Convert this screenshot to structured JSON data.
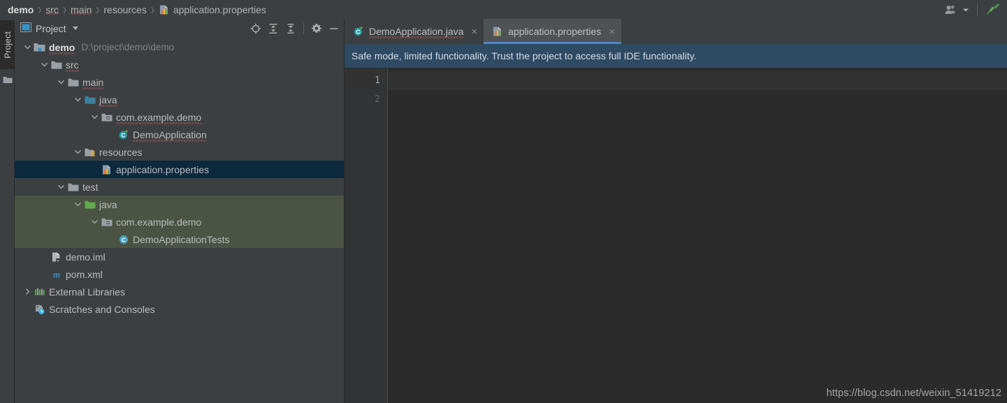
{
  "navbar": {
    "crumbs": [
      {
        "label": "demo",
        "icon": "",
        "root": true,
        "squiggle": false
      },
      {
        "label": "src",
        "icon": "",
        "root": false,
        "squiggle": true
      },
      {
        "label": "main",
        "icon": "",
        "root": false,
        "squiggle": true
      },
      {
        "label": "resources",
        "icon": "",
        "root": false,
        "squiggle": false
      },
      {
        "label": "application.properties",
        "icon": "properties-file-icon",
        "root": false,
        "squiggle": false
      }
    ],
    "separator": "›",
    "right_icons": [
      {
        "name": "user-account-icon",
        "label": ""
      },
      {
        "name": "chevron-down-icon",
        "label": ""
      },
      {
        "name": "build-hammer-icon",
        "label": ""
      }
    ]
  },
  "toolstrip": {
    "tab_label": "Project",
    "icon_name": "folder-icon"
  },
  "project_panel": {
    "title": "Project",
    "actions": [
      {
        "name": "select-opened-file-icon",
        "tooltip": "Select Opened File"
      },
      {
        "name": "expand-all-icon",
        "tooltip": "Expand All"
      },
      {
        "name": "collapse-all-icon",
        "tooltip": "Collapse All"
      },
      {
        "name": "settings-gear-icon",
        "tooltip": "Settings"
      },
      {
        "name": "hide-panel-icon",
        "tooltip": "Hide"
      }
    ],
    "tree": [
      {
        "label": "demo",
        "sub": "D:\\project\\demo\\demo",
        "depth": 0,
        "arrow": "expanded",
        "icon": "module-folder-icon",
        "bold": true,
        "selected": false,
        "testzone": false,
        "squiggle": true
      },
      {
        "label": "src",
        "sub": "",
        "depth": 1,
        "arrow": "expanded",
        "icon": "folder-icon",
        "bold": false,
        "selected": false,
        "testzone": false,
        "squiggle": true
      },
      {
        "label": "main",
        "sub": "",
        "depth": 2,
        "arrow": "expanded",
        "icon": "folder-icon",
        "bold": false,
        "selected": false,
        "testzone": false,
        "squiggle": true
      },
      {
        "label": "java",
        "sub": "",
        "depth": 3,
        "arrow": "expanded",
        "icon": "source-folder-icon",
        "bold": false,
        "selected": false,
        "testzone": false,
        "squiggle": true
      },
      {
        "label": "com.example.demo",
        "sub": "",
        "depth": 4,
        "arrow": "expanded",
        "icon": "package-icon",
        "bold": false,
        "selected": false,
        "testzone": false,
        "squiggle": true
      },
      {
        "label": "DemoApplication",
        "sub": "",
        "depth": 5,
        "arrow": "none",
        "icon": "spring-class-icon",
        "bold": false,
        "selected": false,
        "testzone": false,
        "squiggle": true
      },
      {
        "label": "resources",
        "sub": "",
        "depth": 3,
        "arrow": "expanded",
        "icon": "resources-folder-icon",
        "bold": false,
        "selected": false,
        "testzone": false,
        "squiggle": false
      },
      {
        "label": "application.properties",
        "sub": "",
        "depth": 4,
        "arrow": "none",
        "icon": "properties-file-icon",
        "bold": false,
        "selected": true,
        "testzone": false,
        "squiggle": false
      },
      {
        "label": "test",
        "sub": "",
        "depth": 2,
        "arrow": "expanded",
        "icon": "folder-icon",
        "bold": false,
        "selected": false,
        "testzone": false,
        "squiggle": false
      },
      {
        "label": "java",
        "sub": "",
        "depth": 3,
        "arrow": "expanded",
        "icon": "test-source-folder-icon",
        "bold": false,
        "selected": false,
        "testzone": true,
        "squiggle": false
      },
      {
        "label": "com.example.demo",
        "sub": "",
        "depth": 4,
        "arrow": "expanded",
        "icon": "package-icon",
        "bold": false,
        "selected": false,
        "testzone": true,
        "squiggle": false
      },
      {
        "label": "DemoApplicationTests",
        "sub": "",
        "depth": 5,
        "arrow": "none",
        "icon": "class-icon",
        "bold": false,
        "selected": false,
        "testzone": true,
        "squiggle": false
      },
      {
        "label": "demo.iml",
        "sub": "",
        "depth": 1,
        "arrow": "none",
        "icon": "iml-file-icon",
        "bold": false,
        "selected": false,
        "testzone": false,
        "squiggle": false
      },
      {
        "label": "pom.xml",
        "sub": "",
        "depth": 1,
        "arrow": "none",
        "icon": "maven-file-icon",
        "bold": false,
        "selected": false,
        "testzone": false,
        "squiggle": false
      },
      {
        "label": "External Libraries",
        "sub": "",
        "depth": 0,
        "arrow": "collapsed",
        "icon": "libraries-icon",
        "bold": false,
        "selected": false,
        "testzone": false,
        "squiggle": false
      },
      {
        "label": "Scratches and Consoles",
        "sub": "",
        "depth": 0,
        "arrow": "none",
        "icon": "scratches-icon",
        "bold": false,
        "selected": false,
        "testzone": false,
        "squiggle": false
      }
    ]
  },
  "editor": {
    "tabs": [
      {
        "label": "DemoApplication.java",
        "icon": "spring-class-icon",
        "active": false,
        "close": "×",
        "squiggle": true
      },
      {
        "label": "application.properties",
        "icon": "properties-file-icon",
        "active": true,
        "close": "×",
        "squiggle": false
      }
    ],
    "notification": "Safe mode, limited functionality. Trust the project to access full IDE functionality.",
    "lines": [
      {
        "number": "1",
        "text": "",
        "current": true
      },
      {
        "number": "2",
        "text": "",
        "current": false
      }
    ],
    "watermark": "https://blog.csdn.net/weixin_51419212"
  },
  "colors": {
    "panel_bg": "#3c3f41",
    "editor_bg": "#2b2b2b",
    "selection_blue": "#0d293e",
    "test_zone_green": "#4b5444",
    "notification_blue": "#2f4a63",
    "tab_active": "#4e5254",
    "tab_underline": "#4a88c7",
    "text_primary": "#bbbbbb",
    "text_dim": "#808080"
  }
}
